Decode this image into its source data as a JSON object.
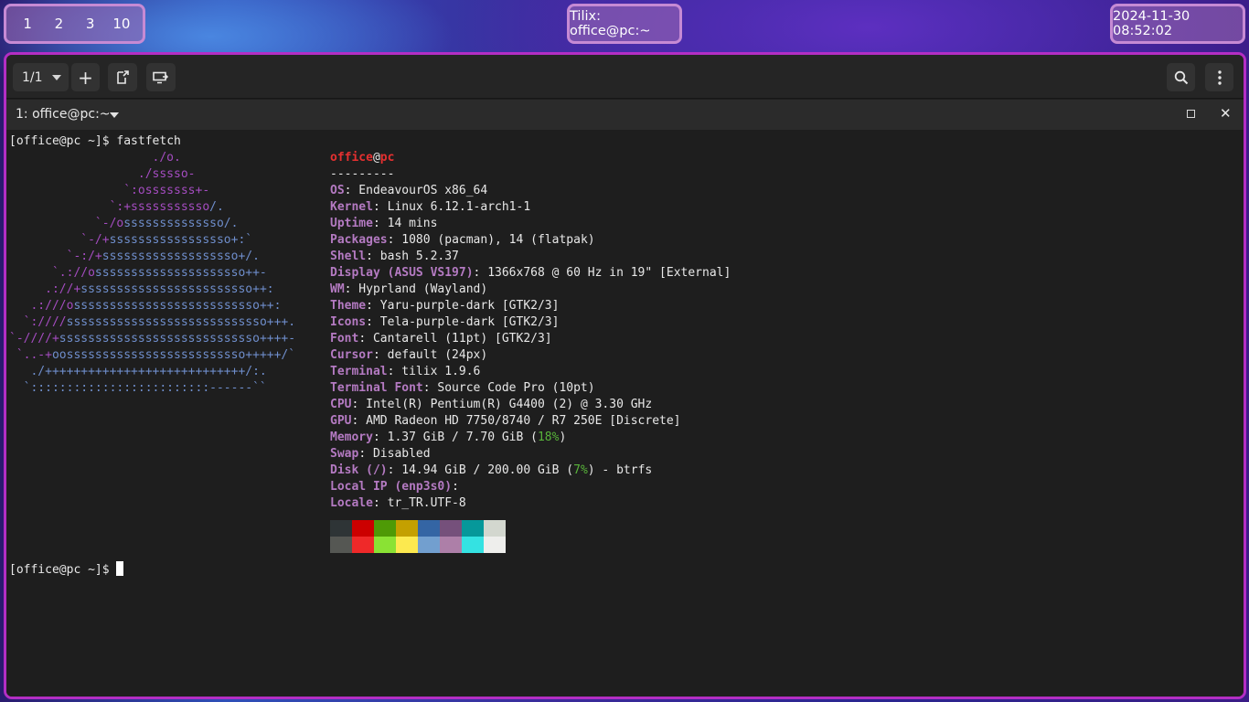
{
  "topbar": {
    "workspaces": [
      "1",
      "2",
      "3",
      "10"
    ],
    "window_title": "Tilix: office@pc:~",
    "clock": "2024-11-30 08:52:02"
  },
  "window": {
    "accent_color": "#b42ec4",
    "headerbar": {
      "session_label": "1/1",
      "add_label": "+",
      "icons": [
        "add-session-icon",
        "sync-input-icon",
        "broadcast-icon",
        "search-icon",
        "menu-icon"
      ]
    },
    "terminal_title": "1: office@pc:~"
  },
  "terminal": {
    "prompt": "[office@pc ~]$ ",
    "command": "fastfetch",
    "logo_lines": [
      {
        "p": "                    ./o.",
        "b": ""
      },
      {
        "p": "                  ./sssso-",
        "b": ""
      },
      {
        "p": "                `:osssssss+-",
        "b": ""
      },
      {
        "p": "              `:+sssssssssso",
        "b": "/."
      },
      {
        "p": "            `-/o",
        "b": "ssssssssssssso/."
      },
      {
        "p": "          `-/+",
        "b": "sssssssssssssssso+:`"
      },
      {
        "p": "        `-:/+",
        "b": "sssssssssssssssssso+/."
      },
      {
        "p": "      `.://o",
        "b": "sssssssssssssssssssso++-"
      },
      {
        "p": "     .://+",
        "b": "ssssssssssssssssssssssso++:"
      },
      {
        "p": "   .:///o",
        "b": "ssssssssssssssssssssssssso++:"
      },
      {
        "p": "  `:////",
        "b": "ssssssssssssssssssssssssssso+++."
      },
      {
        "p": "`-////+",
        "b": "ssssssssssssssssssssssssssso++++-"
      },
      {
        "p": " `..-+",
        "b": "oosssssssssssssssssssssssso+++++/`"
      },
      {
        "p": "",
        "b": "   ./++++++++++++++++++++++++++++/:."
      },
      {
        "p": "",
        "b": "  `:::::::::::::::::::::::::------``"
      }
    ],
    "user": "office",
    "at": "@",
    "host": "pc",
    "separator": "---------",
    "info": [
      {
        "key": "OS",
        "value": ": EndeavourOS x86_64"
      },
      {
        "key": "Kernel",
        "value": ": Linux 6.12.1-arch1-1"
      },
      {
        "key": "Uptime",
        "value": ": 14 mins"
      },
      {
        "key": "Packages",
        "value": ": 1080 (pacman), 14 (flatpak)"
      },
      {
        "key": "Shell",
        "value": ": bash 5.2.37"
      },
      {
        "key": "Display (ASUS VS197)",
        "value": ": 1366x768 @ 60 Hz in 19\" [External]"
      },
      {
        "key": "WM",
        "value": ": Hyprland (Wayland)"
      },
      {
        "key": "Theme",
        "value": ": Yaru-purple-dark [GTK2/3]"
      },
      {
        "key": "Icons",
        "value": ": Tela-purple-dark [GTK2/3]"
      },
      {
        "key": "Font",
        "value": ": Cantarell (11pt) [GTK2/3]"
      },
      {
        "key": "Cursor",
        "value": ": default (24px)"
      },
      {
        "key": "Terminal",
        "value": ": tilix 1.9.6"
      },
      {
        "key": "Terminal Font",
        "value": ": Source Code Pro (10pt)"
      },
      {
        "key": "CPU",
        "value": ": Intel(R) Pentium(R) G4400 (2) @ 3.30 GHz"
      },
      {
        "key": "GPU",
        "value": ": AMD Radeon HD 7750/8740 / R7 250E [Discrete]"
      }
    ],
    "memory": {
      "key": "Memory",
      "pre": ": 1.37 GiB / 7.70 GiB (",
      "pct": "18%",
      "post": ")"
    },
    "swap": {
      "key": "Swap",
      "value": ": Disabled"
    },
    "disk": {
      "key": "Disk (/)",
      "pre": ": 14.94 GiB / 200.00 GiB (",
      "pct": "7%",
      "post": ") - btrfs"
    },
    "local_ip": {
      "key": "Local IP (enp3s0)",
      "value": ":"
    },
    "locale": {
      "key": "Locale",
      "value": ": tr_TR.UTF-8"
    },
    "palette_top": [
      "#2e3436",
      "#cc0000",
      "#4e9a06",
      "#c4a000",
      "#3465a4",
      "#75507b",
      "#06989a",
      "#d3d7cf"
    ],
    "palette_bottom": [
      "#555753",
      "#ef2929",
      "#8ae234",
      "#fce94f",
      "#729fcf",
      "#ad7fa8",
      "#34e2e2",
      "#eeeeec"
    ]
  }
}
